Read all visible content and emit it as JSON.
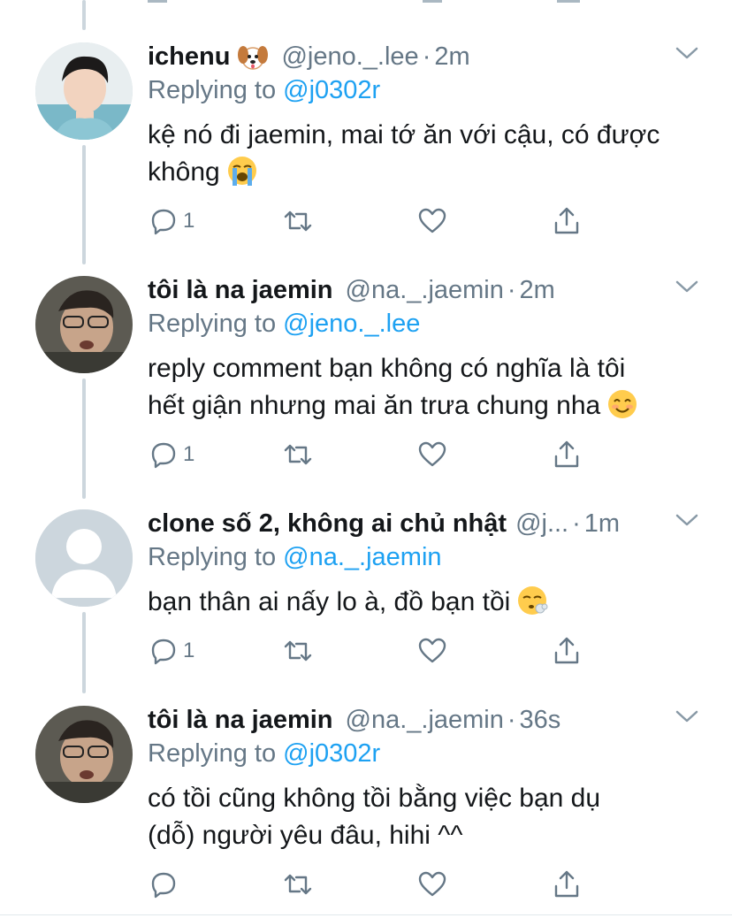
{
  "tweets": [
    {
      "name": "ichenu",
      "name_emoji": "dog-face-emoji",
      "handle": "@jeno._.lee",
      "time": "2m",
      "replying_prefix": "Replying to",
      "replying_to": "@j0302r",
      "body_lines": [
        "kệ nó đi jaemin, mai tớ ăn với cậu, có được",
        "không"
      ],
      "body_emoji": "loudly-crying-face-emoji",
      "reply_count": "1",
      "avatar": "photo-avatar-light"
    },
    {
      "name": "tôi là na jaemin",
      "handle": "@na._.jaemin",
      "time": "2m",
      "replying_prefix": "Replying to",
      "replying_to": "@jeno._.lee",
      "body_lines": [
        "reply comment bạn không có nghĩa là tôi",
        "hết giận nhưng mai ăn trưa chung nha"
      ],
      "body_emoji": "smiling-face-emoji",
      "reply_count": "1",
      "avatar": "photo-avatar-dark"
    },
    {
      "name": "clone số 2, không ai chủ nhật",
      "handle": "@j...",
      "time": "1m",
      "replying_prefix": "Replying to",
      "replying_to": "@na._.jaemin",
      "body_lines": [
        "bạn thân ai nấy lo à, đồ bạn tồi"
      ],
      "body_emoji": "face-exhaling-emoji",
      "reply_count": "1",
      "avatar": "default-avatar"
    },
    {
      "name": "tôi là na jaemin",
      "handle": "@na._.jaemin",
      "time": "36s",
      "replying_prefix": "Replying to",
      "replying_to": "@j0302r",
      "body_lines": [
        "có tồi cũng không tồi bằng việc bạn dụ",
        "(dỗ) người yêu đâu, hihi ^^"
      ],
      "body_emoji": "",
      "reply_count": "",
      "avatar": "photo-avatar-dark"
    }
  ],
  "icons": {
    "reply": "reply-icon",
    "retweet": "retweet-icon",
    "like": "heart-icon",
    "share": "share-icon",
    "menu": "chevron-down-icon"
  },
  "colors": {
    "text": "#14171a",
    "secondary": "#657786",
    "link": "#1da1f2",
    "thread_line": "#ccd6dd"
  }
}
